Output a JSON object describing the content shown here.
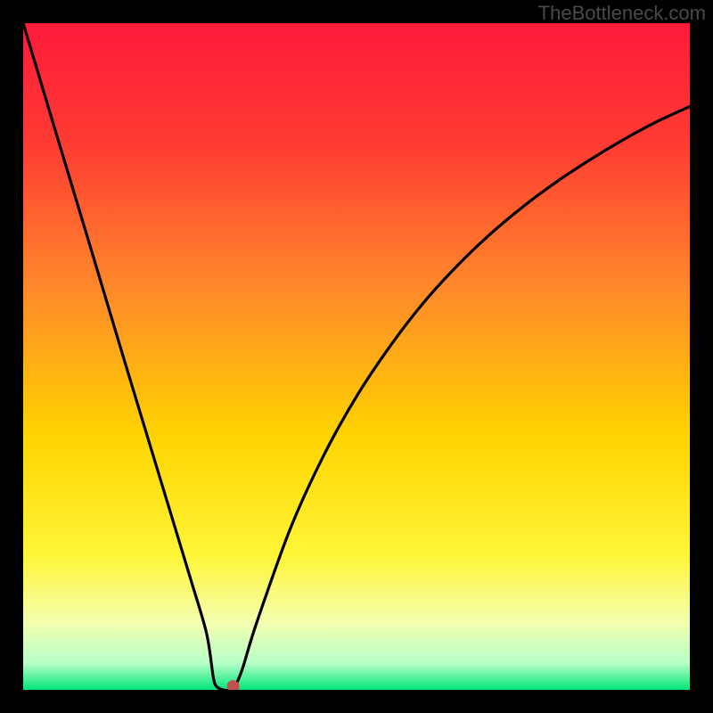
{
  "watermark": "TheBottleneck.com",
  "chart_data": {
    "type": "line",
    "title": "",
    "xlabel": "",
    "ylabel": "",
    "xlim": [
      0,
      100
    ],
    "ylim": [
      0,
      100
    ],
    "background_gradient": {
      "top": "#ff1a3a",
      "mid_upper": "#ff7a2a",
      "mid": "#ffd400",
      "mid_lower": "#f6ff66",
      "bottom": "#00e67a"
    },
    "curve": {
      "description": "V-shaped bottleneck curve with steep quasi-linear left descent and concave right ascent",
      "min_x": 30,
      "min_y": 0,
      "points": [
        {
          "x": 0.0,
          "y": 100.0
        },
        {
          "x": 5.0,
          "y": 83.3
        },
        {
          "x": 10.0,
          "y": 66.7
        },
        {
          "x": 15.0,
          "y": 50.0
        },
        {
          "x": 20.0,
          "y": 33.5
        },
        {
          "x": 25.0,
          "y": 17.0
        },
        {
          "x": 27.5,
          "y": 8.5
        },
        {
          "x": 28.5,
          "y": 2.0
        },
        {
          "x": 29.0,
          "y": 0.5
        },
        {
          "x": 30.0,
          "y": 0.0
        },
        {
          "x": 31.0,
          "y": 0.0
        },
        {
          "x": 32.0,
          "y": 1.0
        },
        {
          "x": 33.0,
          "y": 3.5
        },
        {
          "x": 35.0,
          "y": 10.0
        },
        {
          "x": 40.0,
          "y": 24.0
        },
        {
          "x": 45.0,
          "y": 35.0
        },
        {
          "x": 50.0,
          "y": 44.0
        },
        {
          "x": 55.0,
          "y": 51.5
        },
        {
          "x": 60.0,
          "y": 58.0
        },
        {
          "x": 65.0,
          "y": 63.5
        },
        {
          "x": 70.0,
          "y": 68.3
        },
        {
          "x": 75.0,
          "y": 72.5
        },
        {
          "x": 80.0,
          "y": 76.2
        },
        {
          "x": 85.0,
          "y": 79.5
        },
        {
          "x": 90.0,
          "y": 82.5
        },
        {
          "x": 95.0,
          "y": 85.2
        },
        {
          "x": 100.0,
          "y": 87.5
        }
      ]
    },
    "marker": {
      "x": 31.5,
      "y": 0.5,
      "color": "#c0504d",
      "radius_px": 7
    }
  }
}
